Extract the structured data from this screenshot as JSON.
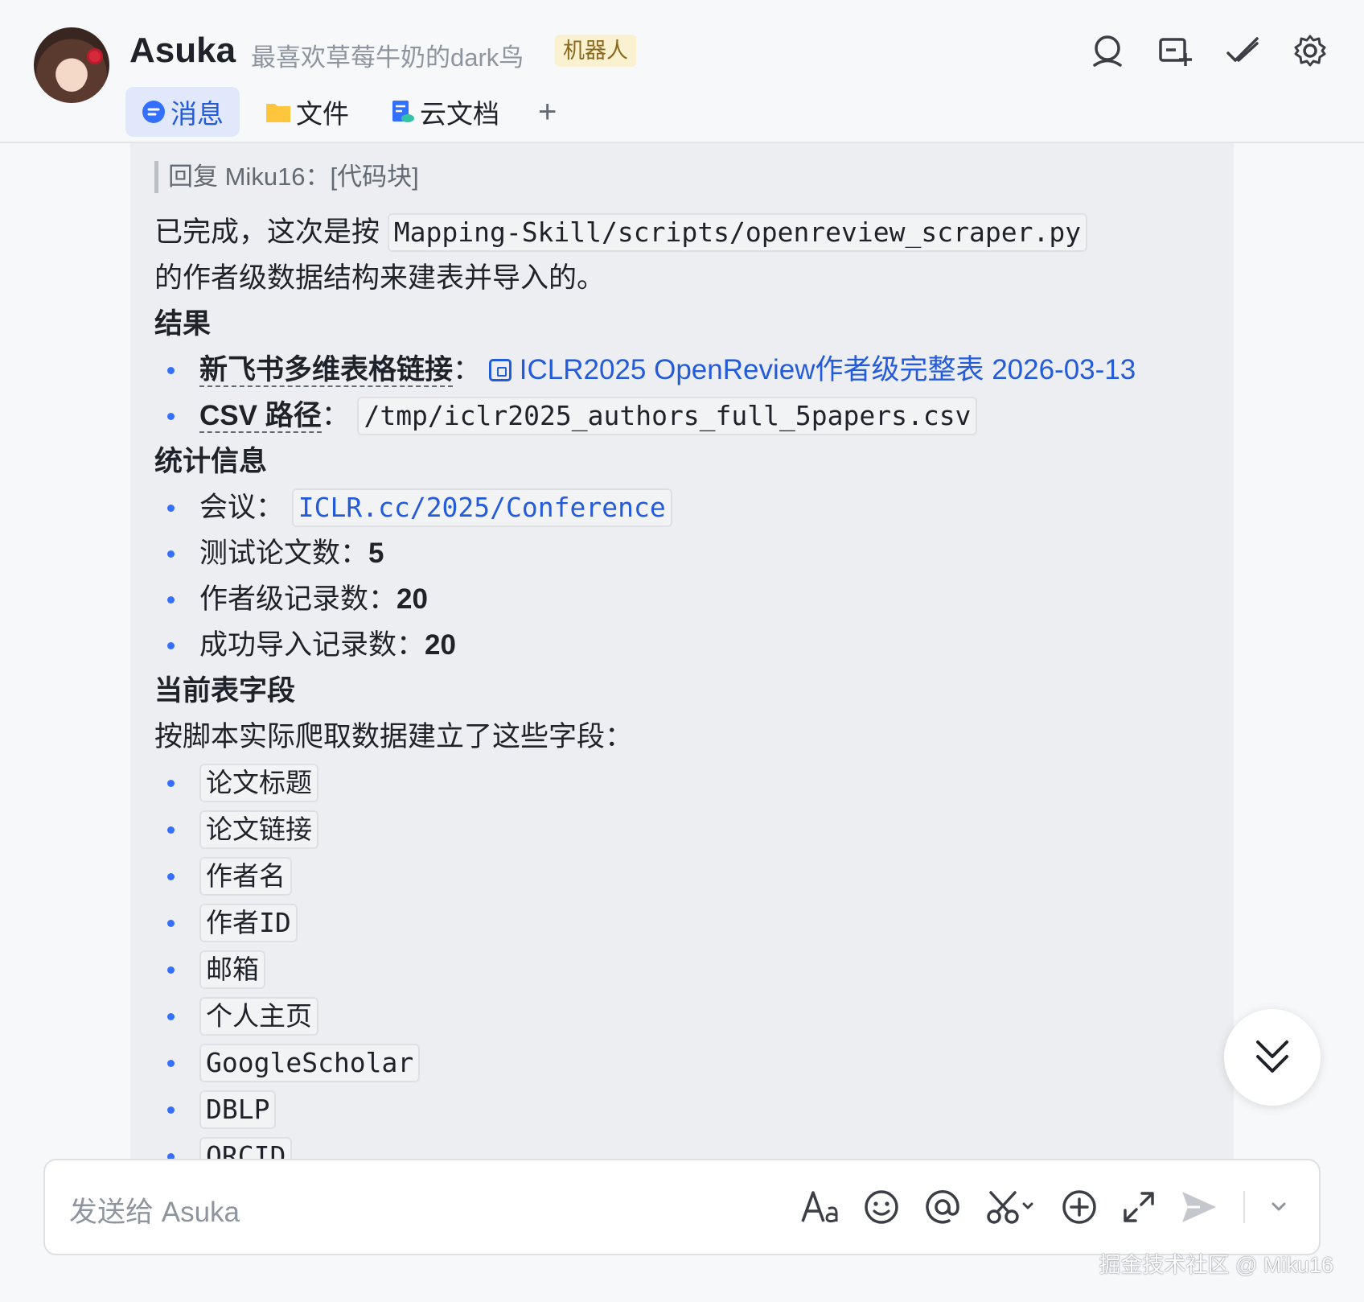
{
  "header": {
    "name": "Asuka",
    "subtitle": "最喜欢草莓牛奶的dark鸟",
    "badge": "机器人",
    "icons": [
      "search-icon",
      "add-chat-icon",
      "checkmark-icon",
      "gear-icon"
    ],
    "tabs": [
      {
        "label": "消息",
        "icon": "message-icon",
        "active": true
      },
      {
        "label": "文件",
        "icon": "folder-icon",
        "active": false
      },
      {
        "label": "云文档",
        "icon": "cloud-doc-icon",
        "active": false
      }
    ],
    "add_tab": "+"
  },
  "message": {
    "reply": "回复 Miku16：[代码块]",
    "intro_prefix": "已完成，这次是按",
    "intro_code": "Mapping-Skill/scripts/openreview_scraper.py",
    "intro_suffix": "的作者级数据结构来建表并导入的。",
    "result_heading": "结果",
    "link_label": "新飞书多维表格链接",
    "link_sep": "：",
    "link_text": "ICLR2025 OpenReview作者级完整表 2026-03-13",
    "csv_label": "CSV 路径",
    "csv_sep": "：",
    "csv_path": "/tmp/iclr2025_authors_full_5papers.csv",
    "stats_heading": "统计信息",
    "conf_label": "会议：",
    "conf_value": "ICLR.cc/2025/Conference",
    "papers_label": "测试论文数：",
    "papers_value": "5",
    "authors_label": "作者级记录数：",
    "authors_value": "20",
    "imported_label": "成功导入记录数：",
    "imported_value": "20",
    "fields_heading": "当前表字段",
    "fields_intro": "按脚本实际爬取数据建立了这些字段：",
    "fields": [
      "论文标题",
      "论文链接",
      "作者名",
      "作者ID",
      "邮箱",
      "个人主页",
      "GoogleScholar",
      "DBLP",
      "ORCID"
    ]
  },
  "input": {
    "placeholder": "发送给 Asuka",
    "tools": [
      "font-icon",
      "emoji-icon",
      "mention-icon",
      "scissors-icon",
      "add-icon",
      "expand-icon",
      "send-icon",
      "chevron-down-icon"
    ]
  },
  "watermark": "掘金技术社区 @ Miku16",
  "colors": {
    "accent": "#245bdb",
    "bubble": "#eceef1",
    "badge_bg": "#faf1d1"
  }
}
